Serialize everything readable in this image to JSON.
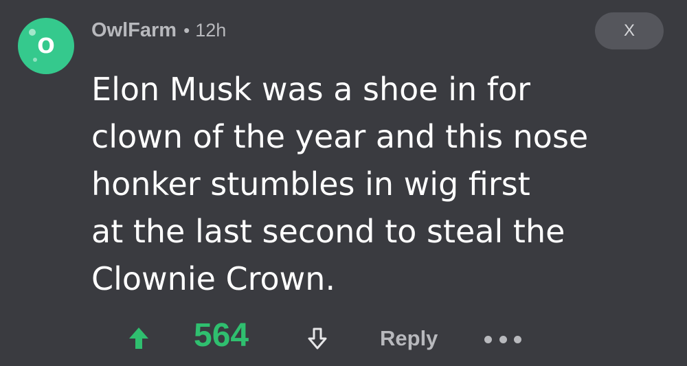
{
  "comment": {
    "avatar": {
      "letter": "O",
      "icon": "owl-avatar-icon",
      "color": "#35c98d"
    },
    "username": "OwlFarm",
    "separator": "•",
    "timestamp": "12h",
    "close_label": "X",
    "body_lines": [
      "Elon Musk was a shoe in for",
      "clown of the year and this nose",
      "honker stumbles in wig first",
      "at the last second to steal the",
      "Clownie Crown."
    ],
    "actions": {
      "upvote_icon": "upvote-arrow-icon",
      "score": "564",
      "score_color": "#2fbf6f",
      "downvote_icon": "downvote-arrow-icon",
      "reply_label": "Reply",
      "more_icon": "more-options-icon"
    }
  }
}
